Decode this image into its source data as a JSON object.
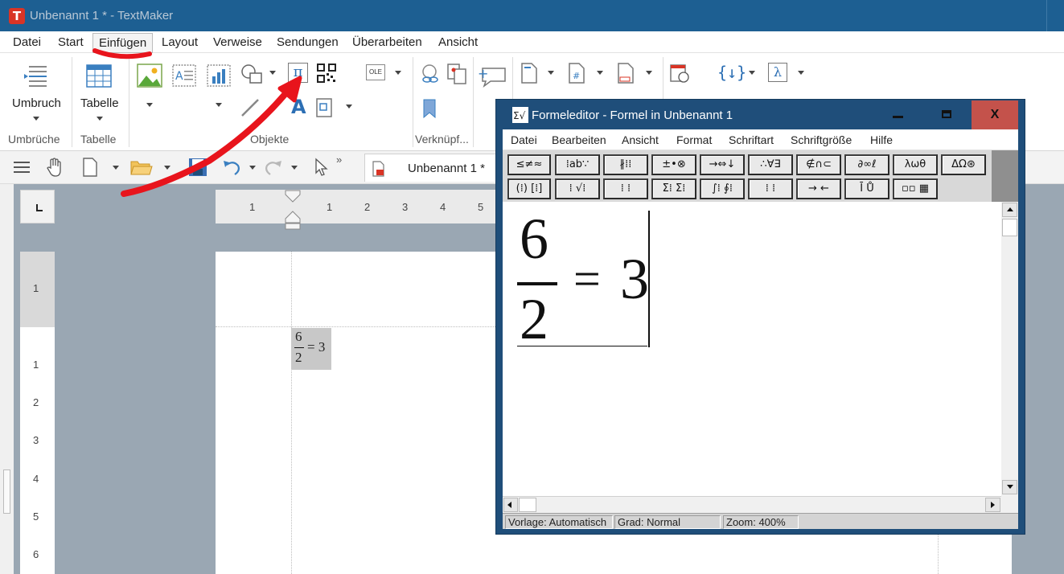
{
  "window": {
    "title": "Unbenannt 1 * - TextMaker",
    "logo_letter": "T"
  },
  "menu": [
    "Datei",
    "Start",
    "Einfügen",
    "Layout",
    "Verweise",
    "Sendungen",
    "Überarbeiten",
    "Ansicht"
  ],
  "ribbon": {
    "umbruch_label": "Umbruch",
    "umbrueche_group": "Umbrüche",
    "tabelle_label": "Tabelle",
    "tabelle_group": "Tabelle",
    "objekte_group": "Objekte",
    "verknuepf_group": "Verknüpf...",
    "ole_label": "OLE"
  },
  "document_tab": "Unbenannt 1 *",
  "ruler": {
    "horizontal_numbers": [
      "1",
      "1",
      "2",
      "3",
      "4",
      "5"
    ],
    "vertical_numbers": [
      "1",
      "1",
      "2",
      "3",
      "4",
      "5",
      "6"
    ]
  },
  "document_formula": {
    "numerator": "6",
    "denominator": "2",
    "rhs": "= 3"
  },
  "dialog": {
    "title": "Formeleditor - Formel in Unbenannt 1",
    "menu": [
      "Datei",
      "Bearbeiten",
      "Ansicht",
      "Format",
      "Schriftart",
      "Schriftgröße",
      "Hilfe"
    ],
    "palette_row1": [
      "≤≠≈",
      "⁞ab∵",
      "∦⁞⁞",
      "±•⊗",
      "→⇔↓",
      "∴∀∃",
      "∉∩⊂",
      "∂∞ℓ",
      "λωθ",
      "ΔΩ⊛"
    ],
    "palette_row2": [
      "(⁞) [⁞]",
      "⁞ √⁞",
      "⁞ ⁞",
      "Σ⁞ Σ⁞",
      "∫⁞ ∮⁞",
      "⁞ ⁞",
      "→ ←",
      "Ī Ů",
      "▫▫ ▦"
    ],
    "formula": {
      "numerator": "6",
      "denominator": "2",
      "equals": "=",
      "rhs": "3"
    },
    "status": {
      "vorlage": "Vorlage: Automatisch",
      "grad": "Grad: Normal",
      "zoom": "Zoom: 400%"
    },
    "buttons": {
      "minimize": "_",
      "maximize": "□",
      "close": "X"
    }
  },
  "colors": {
    "titlebar": "#1d5f92",
    "dialog_border": "#1f4e7a",
    "close_button": "#c4524b",
    "annotation": "#e8141c"
  }
}
